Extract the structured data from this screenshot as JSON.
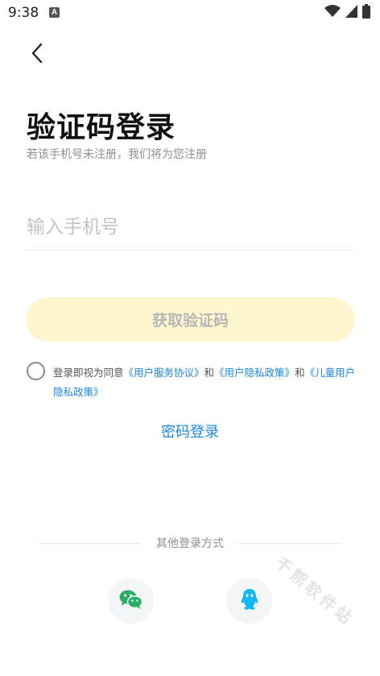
{
  "status_bar": {
    "time": "9:38",
    "app_icon_letter": "A",
    "icons": [
      "wifi-icon",
      "signal-icon",
      "battery-icon"
    ]
  },
  "header": {
    "back_icon": "chevron-left-icon",
    "title": "验证码登录",
    "subtitle": "若该手机号未注册，我们将为您注册"
  },
  "form": {
    "phone_placeholder": "输入手机号",
    "phone_value": "",
    "get_code_label": "获取验证码"
  },
  "agreement": {
    "checked": false,
    "prefix": "登录即视为同意",
    "link1": "《用户服务协议》",
    "and1": "和",
    "link2": "《用户隐私政策》",
    "and2": "和",
    "link3": "《儿童用户隐私政策》"
  },
  "password_login_label": "密码登录",
  "other_login": {
    "label": "其他登录方式",
    "options": [
      "wechat-icon",
      "qq-icon"
    ]
  },
  "watermark": "千熊软件站",
  "colors": {
    "accent_blue": "#1b88e0",
    "button_bg": "#fdf6cf",
    "wechat_green": "#2aae67",
    "qq_blue": "#12b7f5"
  }
}
